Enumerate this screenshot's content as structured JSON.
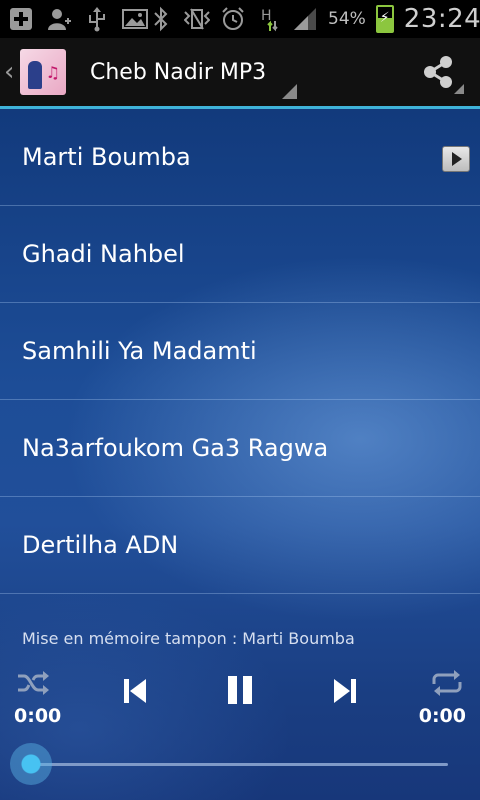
{
  "status_bar": {
    "battery_percent": "54%",
    "time": "23:24",
    "icons": [
      "plus-icon",
      "person-icon",
      "usb-icon",
      "image-icon",
      "bluetooth-icon",
      "vibrate-icon",
      "alarm-icon",
      "data-h-icon",
      "signal-icon",
      "battery-charging-icon"
    ]
  },
  "action_bar": {
    "title": "Cheb Nadir MP3",
    "icon": "app-cover-icon",
    "share_icon": "share-icon"
  },
  "tracks": [
    {
      "name": "Marti Boumba"
    },
    {
      "name": "Ghadi Nahbel"
    },
    {
      "name": "Samhili Ya Madamti"
    },
    {
      "name": "Na3arfoukom Ga3 Ragwa"
    },
    {
      "name": "Dertilha ADN"
    }
  ],
  "player": {
    "buffer_text": "Mise en mémoire tampon : Marti Boumba",
    "elapsed": "0:00",
    "duration": "0:00",
    "progress": 0,
    "controls": [
      "shuffle-icon",
      "previous-icon",
      "pause-icon",
      "next-icon",
      "repeat-icon"
    ]
  },
  "colors": {
    "accent": "#3fb3d9",
    "background_blue": "#1d4d97"
  }
}
